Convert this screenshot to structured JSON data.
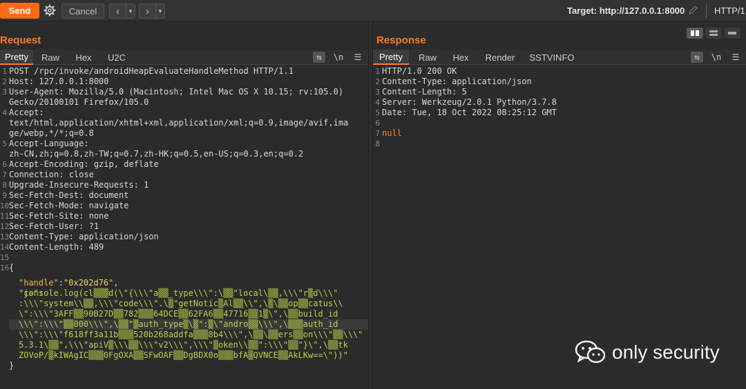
{
  "toolbar": {
    "send_label": "Send",
    "cancel_label": "Cancel",
    "target_label": "Target: http://127.0.0.1:8000",
    "http_version": "HTTP/1"
  },
  "request": {
    "title": "Request",
    "tabs": [
      "Pretty",
      "Raw",
      "Hex",
      "U2C"
    ],
    "active_tab": "Pretty",
    "newline_label": "\\n",
    "lines": [
      {
        "n": "1",
        "text": "POST /rpc/invoke/androidHeapEvaluateHandleMethod HTTP/1.1"
      },
      {
        "n": "2",
        "text": "Host: 127.0.0.1:8000"
      },
      {
        "n": "3",
        "text": "User-Agent: Mozilla/5.0 (Macintosh; Intel Mac OS X 10.15; rv:105.0)"
      },
      {
        "n": "",
        "text": "Gecko/20100101 Firefox/105.0"
      },
      {
        "n": "4",
        "text": "Accept:"
      },
      {
        "n": "",
        "text": "text/html,application/xhtml+xml,application/xml;q=0.9,image/avif,ima"
      },
      {
        "n": "",
        "text": "ge/webp,*/*;q=0.8"
      },
      {
        "n": "5",
        "text": "Accept-Language:"
      },
      {
        "n": "",
        "text": "zh-CN,zh;q=0.8,zh-TW;q=0.7,zh-HK;q=0.5,en-US;q=0.3,en;q=0.2"
      },
      {
        "n": "6",
        "text": "Accept-Encoding: gzip, deflate"
      },
      {
        "n": "7",
        "text": "Connection: close"
      },
      {
        "n": "8",
        "text": "Upgrade-Insecure-Requests: 1"
      },
      {
        "n": "9",
        "text": "Sec-Fetch-Dest: document"
      },
      {
        "n": "10",
        "text": "Sec-Fetch-Mode: navigate"
      },
      {
        "n": "11",
        "text": "Sec-Fetch-Site: none"
      },
      {
        "n": "12",
        "text": "Sec-Fetch-User: ?1"
      },
      {
        "n": "13",
        "text": "Content-Type: application/json"
      },
      {
        "n": "14",
        "text": "Content-Length: 489"
      },
      {
        "n": "15",
        "text": ""
      },
      {
        "n": "16",
        "text": "{"
      }
    ],
    "json_handle_key": "\"handle\"",
    "json_handle_val": "\"0x202d76\",",
    "json_js_key": "\"js\":",
    "js_lines": [
      "\"console.log(cl▒▒▒d(\\\"{\\\\\\\"a▒▒_type\\\\\\\":\\▒▒\"local\\▒▒,\\\\\\\"r▒d\\\\\\\"",
      ":\\\\\\\"system\\\\▒▒,\\\\\\\"code\\\\\\\".\\▒\"getNotic▒Al▒▒\\\\\",\\▒\\▒▒op▒▒catus\\\\",
      "\\\":\\\\\\\"3AFF▒▒90B27D▒▒782▒▒▒64DCE▒▒62FA6▒▒47716▒▒1▒\\\",\\▒▒build_id",
      "\\\\\\\":\\\\\\\"▒▒000\\\\\\\",\\▒▒\"▒auth_type▒\\▒\":▒\\\"andro▒▒\\\\\\\",\\▒▒▒auth_id",
      "\\\\\\\":\\\\\\\"f618ff3a11b▒▒▒520b268addfa▒▒▒8b4\\\\\\\",\\▒▒\\▒▒ers▒▒on\\\\\\\"▒▒\\\\\\\"",
      "5.3.1\\▒▒\",\\\\\\\"apiV▒\\\\\\▒▒\\\\\\\"v2\\\\\\\",\\\\\\\"▒oken\\\\▒▒\":\\\\\\\"▒▒\"}\\\",\\▒▒tk",
      "ZOVoP/▒kIWAgIC▒▒▒0FgOXA▒▒SFwOAF▒▒DgBDX0o▒▒▒bfA▒QVNCE▒▒AkLKw==\\\"))\""
    ],
    "closing": "}"
  },
  "response": {
    "title": "Response",
    "tabs": [
      "Pretty",
      "Raw",
      "Hex",
      "Render",
      "SSTVINFO"
    ],
    "active_tab": "Pretty",
    "newline_label": "\\n",
    "lines": [
      {
        "n": "1",
        "text": "HTTP/1.0 200 OK"
      },
      {
        "n": "2",
        "text": "Content-Type: application/json"
      },
      {
        "n": "3",
        "text": "Content-Length: 5"
      },
      {
        "n": "4",
        "text": "Server: Werkzeug/2.0.1 Python/3.7.8"
      },
      {
        "n": "5",
        "text": "Date: Tue, 18 Oct 2022 08:25:12 GMT"
      },
      {
        "n": "6",
        "text": ""
      },
      {
        "n": "7",
        "text": "null"
      },
      {
        "n": "8",
        "text": ""
      }
    ]
  },
  "watermark": {
    "text": "only security"
  },
  "colors": {
    "accent": "#ff6a13",
    "title": "#ff7a26",
    "background": "#2b2b2b"
  }
}
